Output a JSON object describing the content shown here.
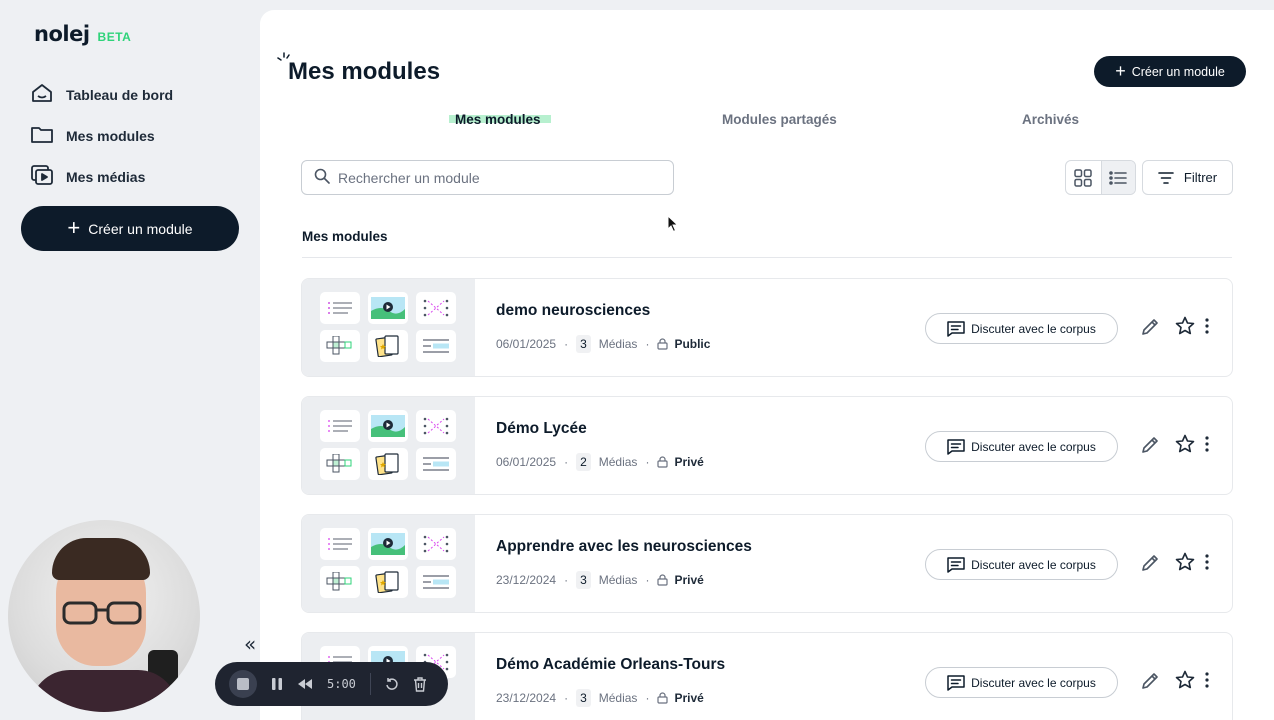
{
  "brand": {
    "name": "nolej",
    "badge": "BETA",
    "accent": "#2fd37a"
  },
  "sidebar": {
    "items": [
      {
        "label": "Tableau de bord",
        "icon": "home-icon"
      },
      {
        "label": "Mes modules",
        "icon": "folder-icon"
      },
      {
        "label": "Mes médias",
        "icon": "media-icon"
      }
    ],
    "create_label": "Créer un module"
  },
  "header": {
    "title": "Mes modules",
    "create_label": "Créer un module"
  },
  "tabs": [
    {
      "label": "Mes modules",
      "active": true
    },
    {
      "label": "Modules partagés",
      "active": false
    },
    {
      "label": "Archivés",
      "active": false
    }
  ],
  "search": {
    "placeholder": "Rechercher un module",
    "value": ""
  },
  "toolbar": {
    "filter_label": "Filtrer",
    "view_mode": "list"
  },
  "section": {
    "title": "Mes modules"
  },
  "modules": [
    {
      "title": "demo neurosciences",
      "date": "06/01/2025",
      "media_count": "3",
      "media_label": "Médias",
      "visibility": "Public",
      "chat_label": "Discuter avec le corpus"
    },
    {
      "title": "Démo Lycée",
      "date": "06/01/2025",
      "media_count": "2",
      "media_label": "Médias",
      "visibility": "Privé",
      "chat_label": "Discuter avec le corpus"
    },
    {
      "title": "Apprendre avec les neurosciences",
      "date": "23/12/2024",
      "media_count": "3",
      "media_label": "Médias",
      "visibility": "Privé",
      "chat_label": "Discuter avec le corpus"
    },
    {
      "title": "Démo Académie Orleans-Tours",
      "date": "23/12/2024",
      "media_count": "3",
      "media_label": "Médias",
      "visibility": "Privé",
      "chat_label": "Discuter avec le corpus"
    }
  ],
  "recorder": {
    "time": "5:00"
  },
  "colors": {
    "dark": "#0d1b2a",
    "highlight": "#b7f0cf",
    "sidebar_bg": "#eef0f3"
  }
}
